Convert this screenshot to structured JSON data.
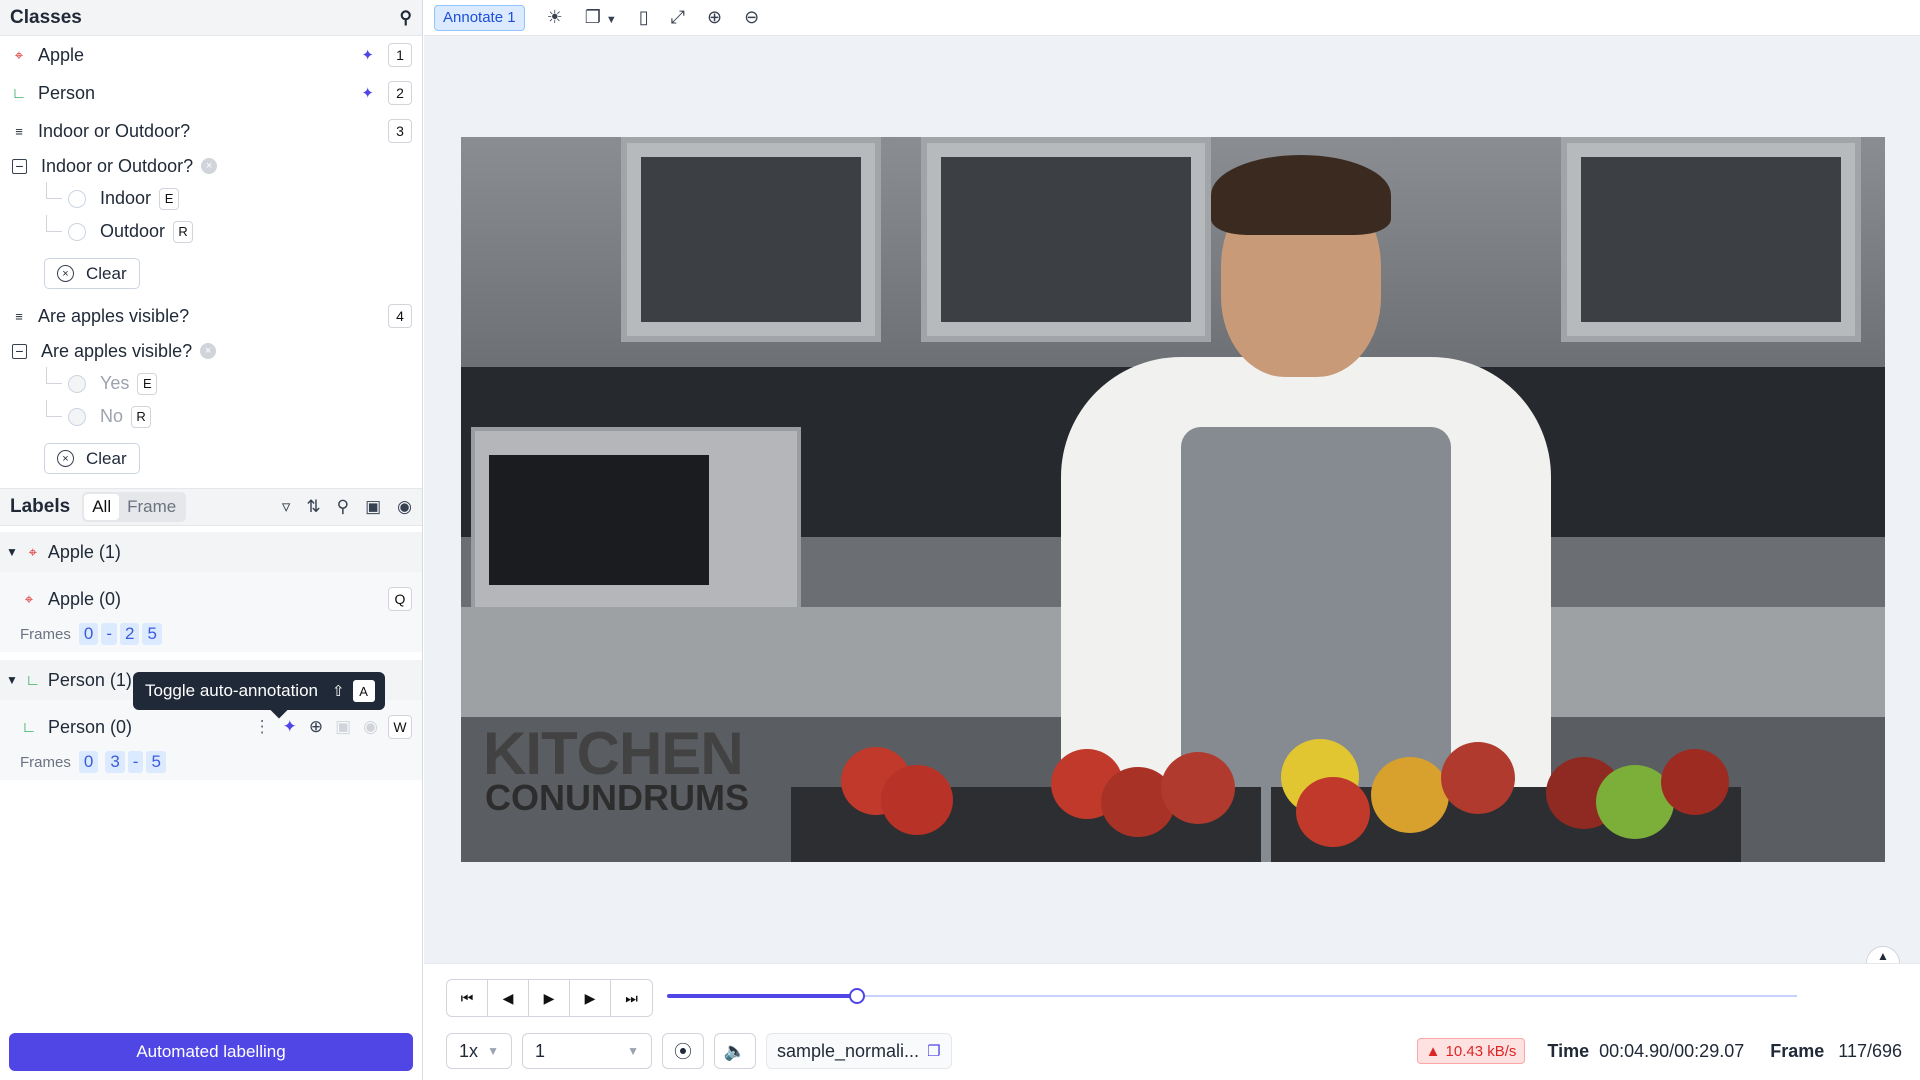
{
  "classes": {
    "title": "Classes",
    "items": [
      {
        "label": "Apple",
        "key": "1"
      },
      {
        "label": "Person",
        "key": "2"
      }
    ],
    "q1": {
      "label": "Indoor or Outdoor?",
      "key": "3",
      "expanded_label": "Indoor or Outdoor?",
      "options": [
        {
          "label": "Indoor",
          "key": "E"
        },
        {
          "label": "Outdoor",
          "key": "R"
        }
      ],
      "clear": "Clear"
    },
    "q2": {
      "label": "Are apples visible?",
      "key": "4",
      "expanded_label": "Are apples visible?",
      "options": [
        {
          "label": "Yes",
          "key": "E"
        },
        {
          "label": "No",
          "key": "R"
        }
      ],
      "clear": "Clear"
    }
  },
  "labels": {
    "title": "Labels",
    "tabs": [
      "All",
      "Frame"
    ],
    "groups": [
      {
        "label": "Apple (1)",
        "instance": "Apple (0)",
        "key": "Q",
        "frames_label": "Frames",
        "frames": [
          "0",
          "-",
          "2",
          "5"
        ]
      },
      {
        "label": "Person (1)",
        "instance": "Person (0)",
        "key": "W",
        "frames_label": "Frames",
        "frames": [
          "0",
          "3",
          "-",
          "5"
        ]
      }
    ]
  },
  "tooltip": {
    "text": "Toggle auto-annotation",
    "shift": "⇧",
    "key": "A"
  },
  "automated_button": "Automated labelling",
  "toolbar": {
    "annotate": "Annotate 1"
  },
  "video": {
    "watermark_1": "KITCHEN",
    "watermark_2": "CONUNDRUMS"
  },
  "player": {
    "progress": 0.168,
    "speed": "1x",
    "step": "1",
    "filename": "sample_normali...",
    "rate": "10.43 kB/s",
    "time_label": "Time",
    "time_value": "00:04.90/00:29.07",
    "frame_label": "Frame",
    "frame_value": "117/696"
  },
  "colors": {
    "accent": "#4f46e5",
    "apple_icon": "#dc2626",
    "person_icon": "#16a34a",
    "warning": "#dc2626"
  }
}
